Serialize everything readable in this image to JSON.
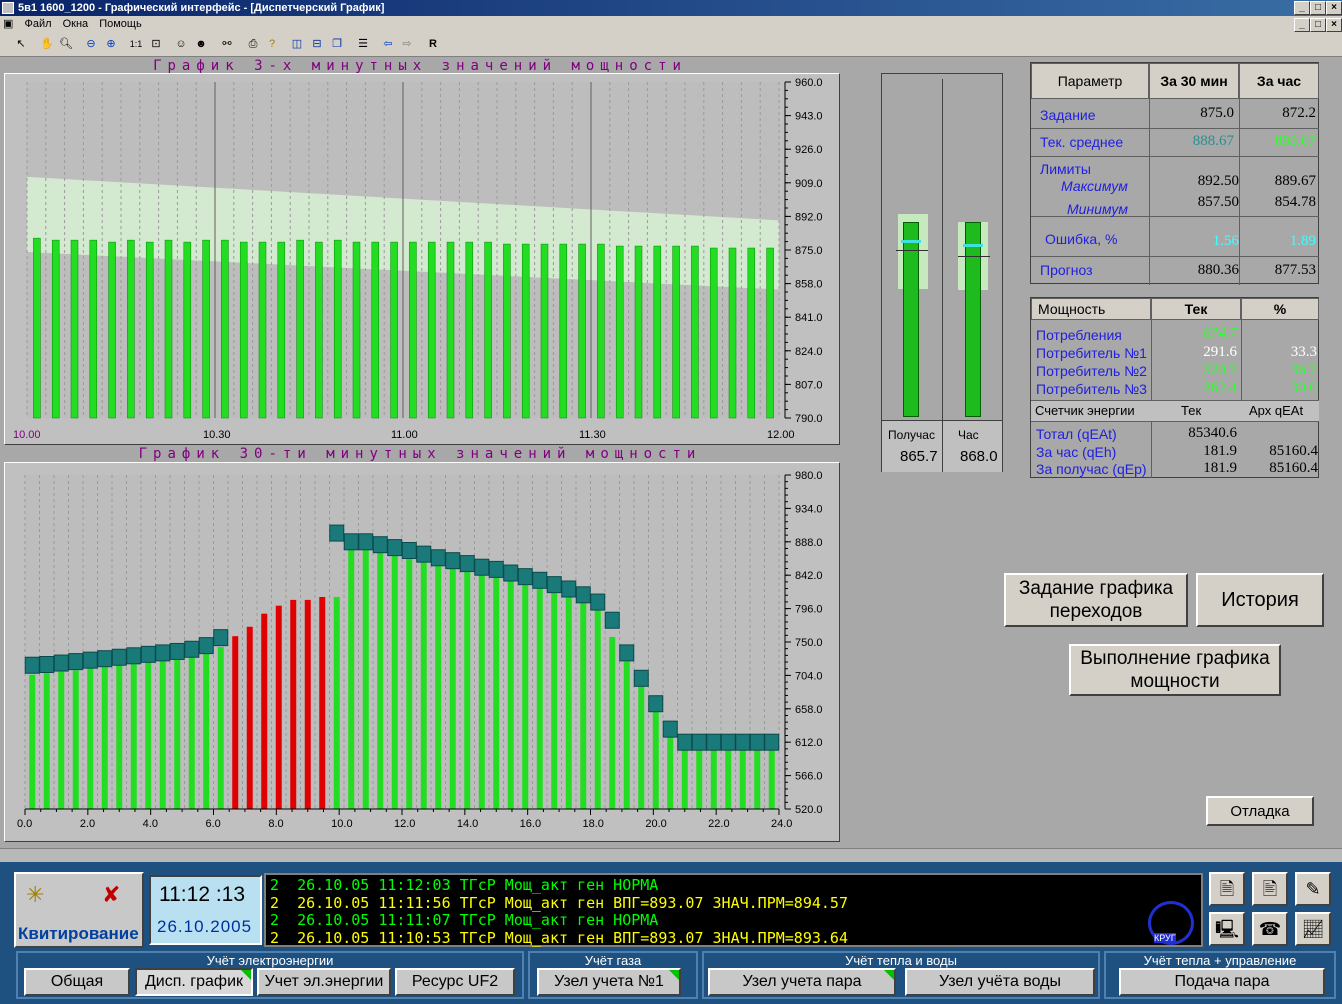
{
  "window": {
    "title": "5в1 1600_1200 - Графический интерфейс - [Диспетчерский График]"
  },
  "menu": {
    "file": "Файл",
    "windows": "Окна",
    "help": "Помощь"
  },
  "chart1": {
    "title": "График 3-х минутных значений мощности"
  },
  "chart2": {
    "title": "График 30-ти минутных значений мощности"
  },
  "chart_data": [
    {
      "type": "bar",
      "title": "График 3-х минутных значений мощности",
      "x_labels": [
        "10.00",
        "10.30",
        "11.00",
        "11.30",
        "12.00"
      ],
      "y_ticks": [
        "960.0",
        "943.0",
        "926.0",
        "909.0",
        "892.0",
        "875.0",
        "858.0",
        "841.0",
        "824.0",
        "807.0",
        "790.0"
      ],
      "ylim": [
        790,
        960
      ],
      "values": [
        881,
        880,
        880,
        880,
        879,
        880,
        879,
        880,
        879,
        880,
        880,
        879,
        879,
        879,
        880,
        879,
        880,
        879,
        879,
        879,
        879,
        879,
        879,
        879,
        879,
        878,
        878,
        878,
        878,
        878,
        878,
        877,
        877,
        877,
        877,
        877,
        876,
        876,
        876,
        876
      ],
      "band_upper_start": 912,
      "band_upper_end": 890,
      "band_lower_start": 874,
      "band_lower_end": 855
    },
    {
      "type": "bar",
      "title": "График 30-ти минутных значений мощности",
      "x_labels": [
        "0.0",
        "2.0",
        "4.0",
        "6.0",
        "8.0",
        "10.0",
        "12.0",
        "14.0",
        "16.0",
        "18.0",
        "20.0",
        "22.0",
        "24.0"
      ],
      "y_ticks": [
        "980.0",
        "934.0",
        "888.0",
        "842.0",
        "796.0",
        "750.0",
        "704.0",
        "658.0",
        "612.0",
        "566.0",
        "520.0"
      ],
      "ylim": [
        520,
        980
      ],
      "values": [
        705,
        707,
        709,
        711,
        714,
        716,
        719,
        721,
        724,
        727,
        730,
        733,
        736,
        743,
        758,
        771,
        789,
        800,
        808,
        808,
        812,
        812,
        880,
        878,
        876,
        874,
        870,
        865,
        863,
        860,
        857,
        855,
        851,
        847,
        841,
        834,
        826,
        817,
        810,
        795,
        757,
        723,
        703,
        665,
        633,
        612,
        612,
        612,
        612,
        612,
        612,
        612
      ],
      "plan": [
        718,
        719,
        721,
        723,
        725,
        727,
        729,
        731,
        733,
        735,
        737,
        740,
        745,
        756,
        779,
        796,
        820,
        840,
        858,
        880,
        890,
        900,
        888,
        888,
        884,
        880,
        876,
        871,
        866,
        862,
        858,
        853,
        850,
        845,
        840,
        835,
        829,
        823,
        815,
        805,
        780,
        735,
        700,
        665,
        630,
        612,
        612,
        612,
        612,
        612,
        612,
        612
      ],
      "red_indices": [
        14,
        15,
        16,
        17,
        18,
        19,
        20
      ],
      "colors": {
        "bar": "#22dd22",
        "red": "#e00000",
        "plan": "#1a7a7a"
      }
    }
  ],
  "table1": {
    "headers": [
      "Параметр",
      "За 30 мин",
      "За час"
    ],
    "rows": {
      "task": {
        "label": "Задание",
        "v30": "875.0",
        "vh": "872.2"
      },
      "avg": {
        "label": "Тек. среднее",
        "v30": "888.67",
        "vh": "888.67"
      },
      "limits": {
        "label": "Лимиты",
        "max_label": "Максимум",
        "min_label": "Минимум",
        "max30": "892.50",
        "maxh": "889.67",
        "min30": "857.50",
        "minh": "854.78"
      },
      "err": {
        "label": "Ошибка, %",
        "v30": "1.56",
        "vh": "1.89"
      },
      "fc": {
        "label": "Прогноз",
        "v30": "880.36",
        "vh": "877.53"
      }
    }
  },
  "table2": {
    "headers": [
      "Мощность",
      "Тек",
      "%"
    ],
    "rows": [
      {
        "label": "Потребления",
        "tek": "874.7",
        "pct": ""
      },
      {
        "label": "Потребитель №1",
        "tek": "291.6",
        "pct": "33.3"
      },
      {
        "label": "Потребитель №2",
        "tek": "320.7",
        "pct": "36.7"
      },
      {
        "label": "Потребитель №3",
        "tek": "262.4",
        "pct": "30.0"
      }
    ],
    "meter_headers": [
      "Счетчик энергии",
      "Тек",
      "Арх qEAt"
    ],
    "meter_rows": [
      {
        "label": "Тотал (qEAt)",
        "tek": "85340.6",
        "arch": ""
      },
      {
        "label": "За час (qEh)",
        "tek": "181.9",
        "arch": "85160.4"
      },
      {
        "label": "За получас (qEp)",
        "tek": "181.9",
        "arch": "85160.4"
      }
    ]
  },
  "gauges": {
    "half_label": "Получас",
    "hour_label": "Час",
    "half_value": "865.7",
    "hour_value": "868.0",
    "half_level": 0.78,
    "hour_level": 0.77
  },
  "buttons": {
    "schedule": "Задание графика переходов",
    "history": "История",
    "exec": "Выполнение графика мощности",
    "debug": "Отладка"
  },
  "status": {
    "ack": "Квитирование",
    "time": "11:12 :13",
    "date": "26.10.2005",
    "logo": "КРУГ"
  },
  "messages": [
    {
      "text": "2  26.10.05 11:12:03 ТГсР Мощ_акт ген НОРМА",
      "color": "#00ff00"
    },
    {
      "text": "2  26.10.05 11:11:56 ТГсР Мощ_акт ген ВПГ=893.07 ЗНАЧ.ПРМ=894.57",
      "color": "#ffff00"
    },
    {
      "text": "2  26.10.05 11:11:07 ТГсР Мощ_акт ген НОРМА",
      "color": "#00ff00"
    },
    {
      "text": "2  26.10.05 11:10:53 ТГсР Мощ_акт ген ВПГ=893.07 ЗНАЧ.ПРМ=893.64",
      "color": "#ffff00"
    }
  ],
  "nav": {
    "groups": [
      "Учёт электроэнергии",
      "Учёт газа",
      "Учёт тепла и воды",
      "Учёт тепла + управление"
    ],
    "general": "Общая",
    "disp": "Дисп. график",
    "elec": "Учет эл.энергии",
    "uf2": "Ресурс UF2",
    "gas1": "Узел учета №1",
    "steam": "Узел учета пара",
    "water": "Узел учёта воды",
    "feed": "Подача пара"
  }
}
